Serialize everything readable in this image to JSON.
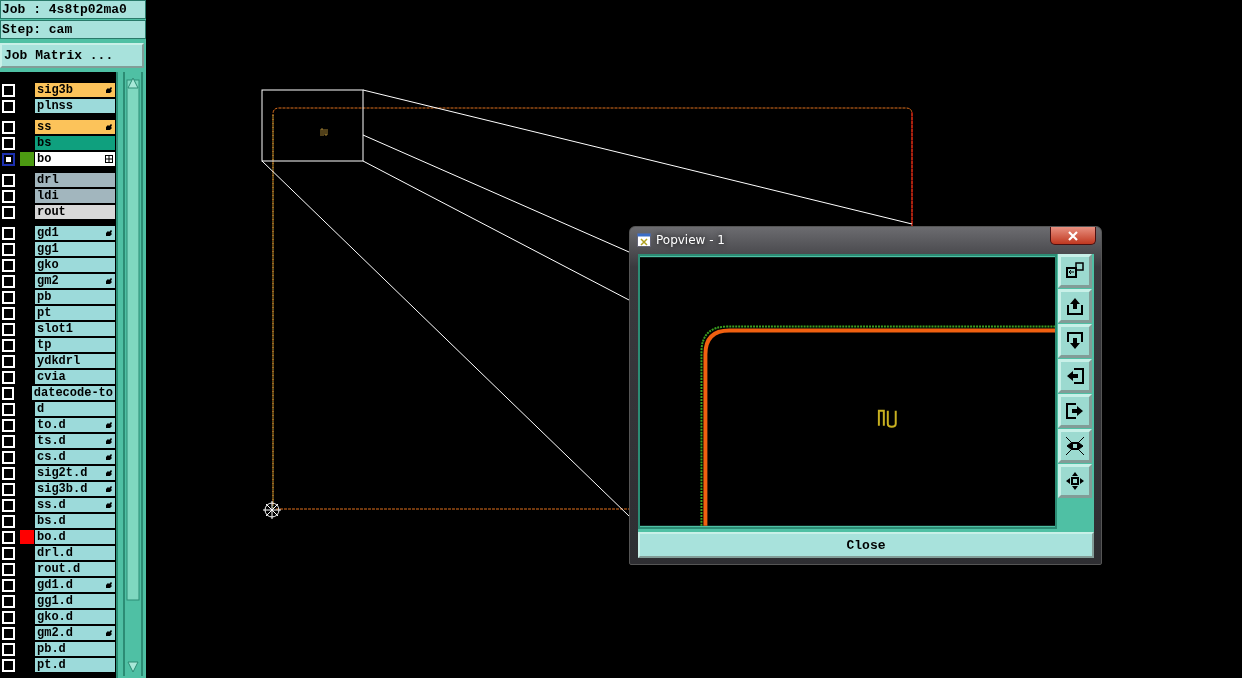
{
  "job_panel": {
    "job": "Job : 4s8tp02ma0",
    "step": "Step: cam",
    "matrix_button": "Job Matrix ..."
  },
  "layer_groups": [
    {
      "layers": [
        {
          "name": "sig3b",
          "color": "#fcc35a",
          "kind": "hand",
          "affected": false
        },
        {
          "name": "plnss",
          "color": "#9cdada",
          "kind": "plain",
          "affected": false
        }
      ]
    },
    {
      "layers": [
        {
          "name": "ss",
          "color": "#fcc35a",
          "kind": "hand",
          "affected": false
        },
        {
          "name": "bs",
          "color": "#0fa07e",
          "kind": "plain",
          "affected": false
        },
        {
          "name": "bo",
          "color": "#ffffff",
          "kind": "grid",
          "affected": true,
          "display": {
            "color": "#4c9a12"
          }
        }
      ]
    },
    {
      "layers": [
        {
          "name": "drl",
          "color": "#a2b6be",
          "kind": "plain",
          "affected": false
        },
        {
          "name": "ldi",
          "color": "#a2b6be",
          "kind": "plain",
          "affected": false
        },
        {
          "name": "rout",
          "color": "#d8d8d8",
          "kind": "plain",
          "affected": false
        }
      ]
    },
    {
      "layers": [
        {
          "name": "gd1",
          "color": "#9cdada",
          "kind": "hand",
          "affected": false
        },
        {
          "name": "gg1",
          "color": "#9cdada",
          "kind": "plain",
          "affected": false
        },
        {
          "name": "gko",
          "color": "#9cdada",
          "kind": "plain",
          "affected": false
        },
        {
          "name": "gm2",
          "color": "#9cdada",
          "kind": "hand",
          "affected": false
        },
        {
          "name": "pb",
          "color": "#9cdada",
          "kind": "plain",
          "affected": false
        },
        {
          "name": "pt",
          "color": "#9cdada",
          "kind": "plain",
          "affected": false
        },
        {
          "name": "slot1",
          "color": "#9cdada",
          "kind": "plain",
          "affected": false
        },
        {
          "name": "tp",
          "color": "#9cdada",
          "kind": "plain",
          "affected": false
        },
        {
          "name": "ydkdrl",
          "color": "#9cdada",
          "kind": "plain",
          "affected": false
        },
        {
          "name": "cvia",
          "color": "#9cdada",
          "kind": "plain",
          "affected": false
        },
        {
          "name": "datecode-to",
          "color": "#9cdada",
          "kind": "plain",
          "affected": false
        },
        {
          "name": "d",
          "color": "#9cdada",
          "kind": "plain",
          "affected": false
        },
        {
          "name": "to.d",
          "color": "#9cdada",
          "kind": "hand",
          "affected": false
        },
        {
          "name": "ts.d",
          "color": "#9cdada",
          "kind": "hand",
          "affected": false
        },
        {
          "name": "cs.d",
          "color": "#9cdada",
          "kind": "hand",
          "affected": false
        },
        {
          "name": "sig2t.d",
          "color": "#9cdada",
          "kind": "hand",
          "affected": false
        },
        {
          "name": "sig3b.d",
          "color": "#9cdada",
          "kind": "hand",
          "affected": false
        },
        {
          "name": "ss.d",
          "color": "#9cdada",
          "kind": "hand",
          "affected": false
        },
        {
          "name": "bs.d",
          "color": "#9cdada",
          "kind": "plain",
          "affected": false
        },
        {
          "name": "bo.d",
          "color": "#9cdada",
          "kind": "plain",
          "affected": false,
          "display": {
            "color": "#ff0000"
          }
        },
        {
          "name": "drl.d",
          "color": "#9cdada",
          "kind": "plain",
          "affected": false
        },
        {
          "name": "rout.d",
          "color": "#9cdada",
          "kind": "plain",
          "affected": false
        },
        {
          "name": "gd1.d",
          "color": "#9cdada",
          "kind": "hand",
          "affected": false
        },
        {
          "name": "gg1.d",
          "color": "#9cdada",
          "kind": "plain",
          "affected": false
        },
        {
          "name": "gko.d",
          "color": "#9cdada",
          "kind": "plain",
          "affected": false
        },
        {
          "name": "gm2.d",
          "color": "#9cdada",
          "kind": "hand",
          "affected": false
        },
        {
          "name": "pb.d",
          "color": "#9cdada",
          "kind": "plain",
          "affected": false
        },
        {
          "name": "pt.d",
          "color": "#9cdada",
          "kind": "plain",
          "affected": false
        }
      ]
    }
  ],
  "popview": {
    "title": "Popview - 1",
    "close_label": "Close"
  }
}
